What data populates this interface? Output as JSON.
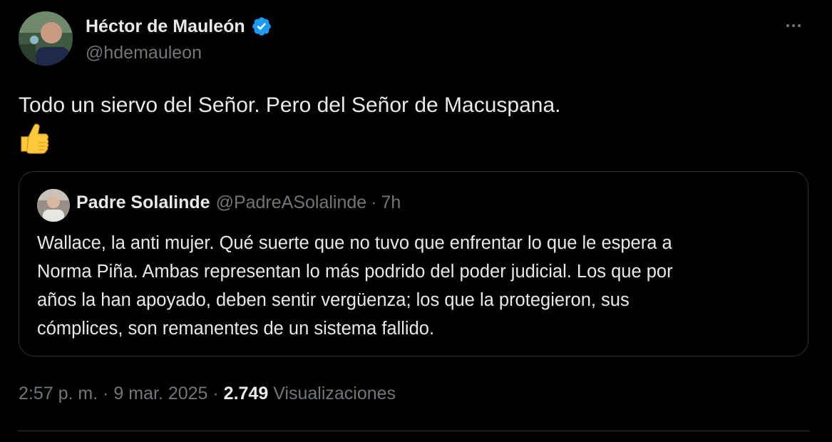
{
  "author": {
    "display_name": "Héctor de Mauleón",
    "handle": "@hdemauleon",
    "verified": true
  },
  "tweet": {
    "text": "Todo un siervo del Señor. Pero del Señor de Macuspana.",
    "emoji_icon": "thumbs-up-icon"
  },
  "quoted_tweet": {
    "display_name": "Padre Solalinde",
    "handle": "@PadreASolalinde",
    "separator": "·",
    "time_ago": "7h",
    "text_lines": [
      "Wallace, la anti mujer. Qué suerte que no tuvo que enfrentar lo que le espera a",
      "Norma Piña. Ambas representan lo más podrido del poder judicial. Los que por",
      "años la han apoyado, deben sentir vergüenza; los que la protegieron, sus",
      "cómplices, son remanentes de un sistema fallido."
    ]
  },
  "meta": {
    "time": "2:57 p. m.",
    "sep1": "·",
    "date": "9 mar. 2025",
    "sep2": "·",
    "views_count": "2.749",
    "views_label": "Visualizaciones"
  },
  "colors": {
    "background": "#000000",
    "text_primary": "#e7e9ea",
    "text_secondary": "#71767b",
    "border": "#2f3336",
    "verified_badge": "#1d9bf0",
    "emoji_yellow": "#ffc83d"
  }
}
